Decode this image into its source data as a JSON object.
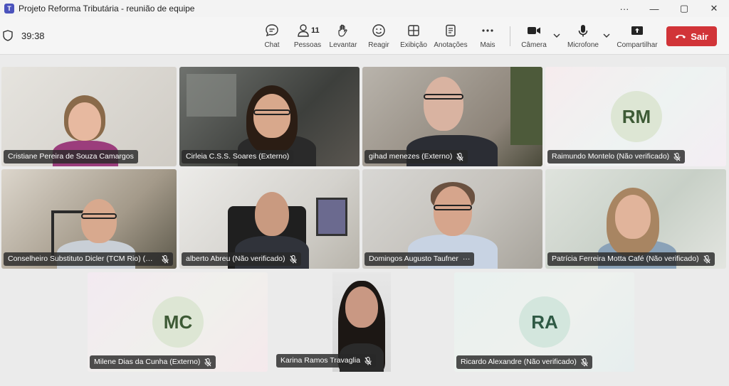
{
  "window": {
    "title": "Projeto Reforma Tributária - reunião de equipe",
    "logo_letter": "T",
    "controls": [
      "···",
      "—",
      "▢",
      "✕"
    ]
  },
  "toolbar": {
    "timer": "39:38",
    "people_count": "11",
    "items": {
      "chat": "Chat",
      "people": "Pessoas",
      "raise": "Levantar",
      "react": "Reagir",
      "view": "Exibição",
      "notes": "Anotações",
      "more": "Mais",
      "camera": "Câmera",
      "mic": "Microfone",
      "share": "Compartilhar"
    },
    "leave_label": "Sair",
    "leave_color": "#d13438"
  },
  "participants": [
    {
      "name": "Cristiane Pereira de Souza Camargos",
      "muted": false,
      "video": true
    },
    {
      "name": "Cirleia C.S.S. Soares (Externo)",
      "muted": false,
      "video": true
    },
    {
      "name": "gihad menezes (Externo)",
      "muted": true,
      "video": true
    },
    {
      "name": "Raimundo Montelo (Não verificado)",
      "muted": true,
      "video": false,
      "initials": "RM"
    },
    {
      "name": "Conselheiro Substituto Dicler (TCM Rio) (Não verificado)",
      "muted": true,
      "video": true
    },
    {
      "name": "alberto Abreu (Não verificado)",
      "muted": true,
      "video": true
    },
    {
      "name": "Domingos Augusto Taufner",
      "muted": false,
      "video": true,
      "more": "···"
    },
    {
      "name": "Patrícia Ferreira Motta Café (Não verificado)",
      "muted": true,
      "video": true
    },
    {
      "name": "Milene Dias da Cunha (Externo)",
      "muted": true,
      "video": false,
      "initials": "MC"
    },
    {
      "name": "Karina Ramos Travaglia",
      "muted": true,
      "video": true
    },
    {
      "name": "Ricardo Alexandre (Não verificado)",
      "muted": true,
      "video": false,
      "initials": "RA"
    }
  ]
}
